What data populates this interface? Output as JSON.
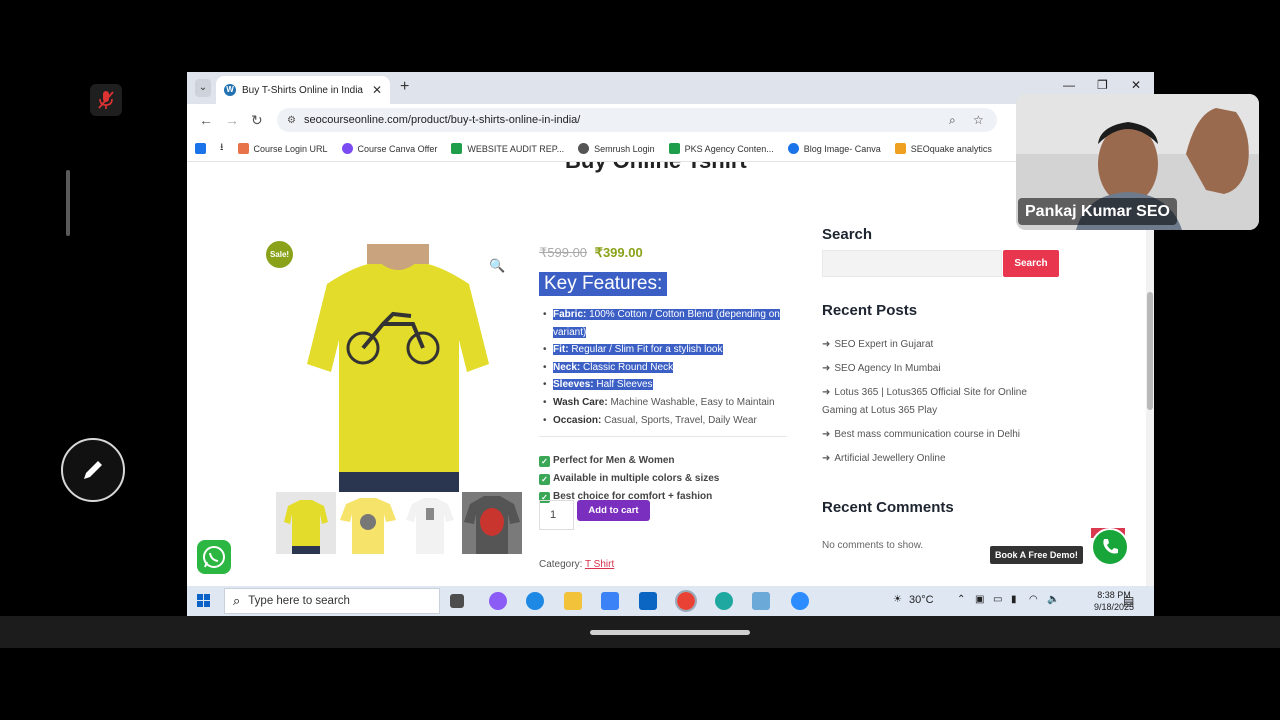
{
  "browser": {
    "tab_title": "Buy T-Shirts Online in India | Tr",
    "url": "seocourseonline.com/product/buy-t-shirts-online-in-india/",
    "bookmarks": [
      {
        "label": "Course Login URL",
        "color": "#e8734a"
      },
      {
        "label": "Course Canva Offer",
        "color": "#7a4cf2"
      },
      {
        "label": "WEBSITE AUDIT REP...",
        "color": "#1e9e4b"
      },
      {
        "label": "Semrush Login",
        "color": "#555555"
      },
      {
        "label": "PKS Agency Conten...",
        "color": "#1e9e4b"
      },
      {
        "label": "Blog Image- Canva",
        "color": "#1a73e8"
      },
      {
        "label": "SEOquake analytics",
        "color": "#f0a020"
      }
    ]
  },
  "product": {
    "page_title_fragment": "Buy Online Tshirt",
    "sale_badge": "Sale!",
    "old_price": "₹599.00",
    "new_price": "₹399.00",
    "key_features_heading": "Key Features:",
    "features": [
      {
        "label": "Fabric:",
        "value": "100% Cotton / Cotton Blend (depending on variant)",
        "selected": true
      },
      {
        "label": "Fit:",
        "value": "Regular / Slim Fit for a stylish look",
        "selected": true
      },
      {
        "label": "Neck:",
        "value": "Classic Round Neck",
        "selected": true
      },
      {
        "label": "Sleeves:",
        "value": "Half Sleeves",
        "selected": true
      },
      {
        "label": "Wash Care:",
        "value": "Machine Washable, Easy to Maintain",
        "selected": false
      },
      {
        "label": "Occasion:",
        "value": "Casual, Sports, Travel, Daily Wear",
        "selected": false
      }
    ],
    "checks": [
      "Perfect for Men & Women",
      "Available in multiple colors & sizes",
      "Best choice for comfort + fashion"
    ],
    "quantity": "1",
    "add_to_cart": "Add to cart",
    "category_label": "Category:",
    "category_value": "T Shirt"
  },
  "sidebar": {
    "search_heading": "Search",
    "search_button": "Search",
    "recent_posts_heading": "Recent Posts",
    "recent_posts": [
      "SEO Expert in Gujarat",
      "SEO Agency In Mumbai",
      "Lotus 365 | Lotus365 Official Site for Online Gaming at Lotus 365 Play",
      "Best mass communication course in Delhi",
      "Artificial Jewellery Online"
    ],
    "recent_comments_heading": "Recent Comments",
    "no_comments": "No comments to show."
  },
  "widgets": {
    "demo_label": "Book A Free Demo!"
  },
  "taskbar": {
    "search_placeholder": "Type here to search",
    "temperature": "30°C",
    "time": "8:38 PM",
    "date": "9/18/2025"
  },
  "webcam": {
    "name": "Pankaj Kumar SEO"
  }
}
